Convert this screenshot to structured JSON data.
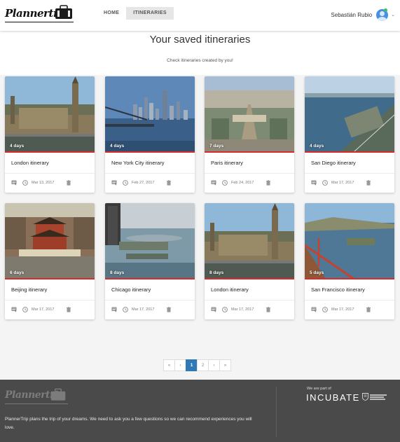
{
  "header": {
    "logo_text": "Plannertrip",
    "nav": [
      {
        "label": "HOME",
        "active": false
      },
      {
        "label": "ITINERARIES",
        "active": true
      }
    ],
    "user_name": "Sebastián Rubio",
    "caret": "⌄"
  },
  "main": {
    "title": "Your saved itineraries",
    "subtitle": "Check itineraries created by you!"
  },
  "itineraries": [
    {
      "title": "London itinerary",
      "days": "4 days",
      "date": "Mar 13, 2017",
      "image": "london"
    },
    {
      "title": "New York City itinerary",
      "days": "4 days",
      "date": "Feb 27, 2017",
      "image": "nyc"
    },
    {
      "title": "Paris itinerary",
      "days": "7 days",
      "date": "Feb 24, 2017",
      "image": "paris"
    },
    {
      "title": "San Diego itinerary",
      "days": "4 days",
      "date": "Mar 17, 2017",
      "image": "sandiego"
    },
    {
      "title": "Beijing itinerary",
      "days": "6 days",
      "date": "Mar 17, 2017",
      "image": "beijing"
    },
    {
      "title": "Chicago itinerary",
      "days": "8 days",
      "date": "Mar 17, 2017",
      "image": "chicago"
    },
    {
      "title": "London itinerary",
      "days": "8 days",
      "date": "Mar 17, 2017",
      "image": "london"
    },
    {
      "title": "San Francisco itinerary",
      "days": "5 days",
      "date": "Mar 17, 2017",
      "image": "sanfrancisco"
    }
  ],
  "pagination": {
    "first": "«",
    "prev": "‹",
    "pages": [
      "1",
      "2"
    ],
    "current": "1",
    "next": "›",
    "last": "»"
  },
  "footer": {
    "logo_text": "Plannertrip",
    "description": "PlannerTrip plans the trip of your dreams. We need to ask you a few questions so we can recommend experiences you will love.",
    "part_of": "We are part of",
    "incubate": "INCUBATE"
  },
  "colors": {
    "accent_red": "#d62c2c",
    "pager_active": "#2f7ab6",
    "footer_bg": "#4a4a4a",
    "avatar_blue": "#4a90e2"
  },
  "icons": {
    "card_actions": [
      "comment-icon",
      "clock-icon",
      "trash-icon"
    ]
  }
}
